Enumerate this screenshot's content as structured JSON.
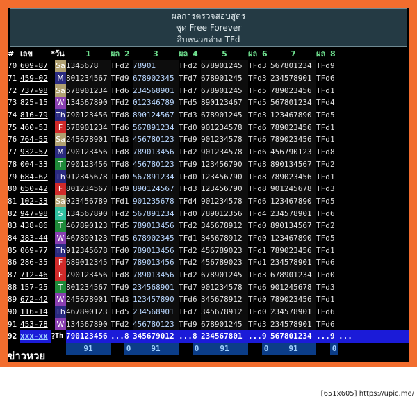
{
  "header": {
    "line1": "ผลการตรวจสอบสูตร",
    "line2": "ชุด Free Forever",
    "line3": "สิบหน่วยล่าง-TFd"
  },
  "columns": [
    "#",
    "เลข",
    "*",
    "วัน",
    "1",
    "ผล",
    "2",
    "3",
    "ผล",
    "4",
    "5",
    "ผล",
    "6",
    "7",
    "ผล",
    "8"
  ],
  "rows": [
    {
      "no": "70",
      "num": "609-87",
      "day": "Sa",
      "c1": "1345678",
      "c1b": "9",
      "c1c": "0",
      "r1": "2",
      "c2": "78901",
      "c2b": "3456",
      "r2": "2",
      "c3": "678901245",
      "r3": "3",
      "c4": "567801234",
      "r4": "9"
    },
    {
      "no": "71",
      "num": "459-02",
      "day": "M",
      "c1": "801234567",
      "r1": "9",
      "c2": "678902345",
      "r2": "7",
      "c3": "678901245",
      "r3": "3",
      "c4": "234578901",
      "r4": "6"
    },
    {
      "no": "72",
      "num": "737-98",
      "day": "Sa",
      "c1": "578901234",
      "r1": "6",
      "c2": "234568901",
      "r2": "7",
      "c3": "678901245",
      "r3": "5",
      "c4": "789023456",
      "r4": "1"
    },
    {
      "no": "73",
      "num": "825-15",
      "day": "W",
      "c1": "134567890",
      "r1": "2",
      "c2": "012346789",
      "r2": "5",
      "c3": "890123467",
      "r3": "5",
      "c4": "567801234",
      "r4": "4"
    },
    {
      "no": "74",
      "num": "816-79",
      "day": "Th",
      "c1": "790123456",
      "r1": "8",
      "c2": "890124567",
      "r2": "3",
      "c3": "678901245",
      "r3": "3",
      "c4": "123467890",
      "r4": "5"
    },
    {
      "no": "75",
      "num": "460-53",
      "day": "F",
      "c1": "578901234",
      "r1": "6",
      "c2": "567891234",
      "r2": "0",
      "c3": "901234578",
      "r3": "6",
      "c4": "789023456",
      "r4": "1"
    },
    {
      "no": "76",
      "num": "764-55",
      "day": "Sa",
      "c1": "245678901",
      "r1": "3",
      "c2": "456780123",
      "r2": "9",
      "c3": "901234578",
      "r3": "6",
      "c4": "789023456",
      "r4": "1"
    },
    {
      "no": "77",
      "num": "932-57",
      "day": "M",
      "c1": "790123456",
      "r1": "8",
      "c2": "789013456",
      "r2": "2",
      "c3": "901234578",
      "r3": "6",
      "c4": "456790123",
      "r4": "8"
    },
    {
      "no": "78",
      "num": "004-33",
      "day": "T",
      "c1": "790123456",
      "r1": "8",
      "c2": "456780123",
      "r2": "9",
      "c3": "123456790",
      "r3": "8",
      "c4": "890134567",
      "r4": "2"
    },
    {
      "no": "79",
      "num": "684-62",
      "day": "Th",
      "c1": "912345678",
      "r1": "0",
      "c2": "567891234",
      "r2": "0",
      "c3": "123456790",
      "r3": "8",
      "c4": "789023456",
      "r4": "1"
    },
    {
      "no": "80",
      "num": "650-42",
      "day": "F",
      "c1": "801234567",
      "r1": "9",
      "c2": "890124567",
      "r2": "3",
      "c3": "123456790",
      "r3": "8",
      "c4": "901245678",
      "r4": "3"
    },
    {
      "no": "81",
      "num": "102-33",
      "day": "Sa",
      "c1": "023456789",
      "r1": "1",
      "c2": "901235678",
      "r2": "4",
      "c3": "901234578",
      "r3": "6",
      "c4": "123467890",
      "r4": "5"
    },
    {
      "no": "82",
      "num": "947-98",
      "day": "S",
      "c1": "134567890",
      "r1": "2",
      "c2": "567891234",
      "r2": "0",
      "c3": "789012356",
      "r3": "4",
      "c4": "234578901",
      "r4": "6"
    },
    {
      "no": "83",
      "num": "438-86",
      "day": "T",
      "c1": "467890123",
      "r1": "5",
      "c2": "789013456",
      "r2": "2",
      "c3": "345678912",
      "r3": "0",
      "c4": "890134567",
      "r4": "2"
    },
    {
      "no": "84",
      "num": "383-44",
      "day": "W",
      "c1": "467890123",
      "r1": "5",
      "c2": "678902345",
      "r2": "1",
      "c3": "345678912",
      "r3": "0",
      "c4": "123467890",
      "r4": "5"
    },
    {
      "no": "85",
      "num": "069-77",
      "day": "Th",
      "c1": "912345678",
      "r1": "0",
      "c2": "789013456",
      "r2": "2",
      "c3": "456789023",
      "r3": "1",
      "c4": "789023456",
      "r4": "1"
    },
    {
      "no": "86",
      "num": "286-35",
      "day": "F",
      "c1": "689012345",
      "r1": "7",
      "c2": "789013456",
      "r2": "2",
      "c3": "456789023",
      "r3": "1",
      "c4": "234578901",
      "r4": "6"
    },
    {
      "no": "87",
      "num": "712-46",
      "day": "F",
      "c1": "790123456",
      "r1": "8",
      "c2": "789013456",
      "r2": "2",
      "c3": "678901245",
      "r3": "3",
      "c4": "678901234",
      "r4": "0"
    },
    {
      "no": "88",
      "num": "157-25",
      "day": "T",
      "c1": "801234567",
      "r1": "9",
      "c2": "234568901",
      "r2": "7",
      "c3": "901234578",
      "r3": "6",
      "c4": "901245678",
      "r4": "3"
    },
    {
      "no": "89",
      "num": "672-42",
      "day": "W",
      "c1": "245678901",
      "r1": "3",
      "c2": "123457890",
      "r2": "6",
      "c3": "345678912",
      "r3": "0",
      "c4": "789023456",
      "r4": "1"
    },
    {
      "no": "90",
      "num": "116-14",
      "day": "Th",
      "c1": "467890123",
      "r1": "5",
      "c2": "234568901",
      "r2": "7",
      "c3": "345678912",
      "r3": "0",
      "c4": "234578901",
      "r4": "6"
    },
    {
      "no": "91",
      "num": "453-78",
      "day": "W",
      "c1": "134567890",
      "r1": "2",
      "c2": "456780123",
      "r2": "9",
      "c3": "678901245",
      "r3": "3",
      "c4": "234578901",
      "r4": "6"
    }
  ],
  "last_row": {
    "no": "92",
    "num": "xxx-xx",
    "q": "?",
    "day": "Th",
    "c1": "790123456",
    "d1": "...",
    "r1": "8",
    "c2": "345679012",
    "d2": "...",
    "r2": "8",
    "c3": "234567801",
    "d3": "...",
    "r3": "9",
    "c4": "567801234",
    "d4": "...",
    "r4": "9",
    "dots": "..."
  },
  "summary": {
    "s1": "91",
    "z1": "0",
    "s2": "91",
    "z2": "0",
    "s3": "91",
    "z3": "0",
    "s4": "91",
    "z4": "0"
  },
  "tfd_label": "TFd",
  "footer_logo": "ข่าวหวย",
  "credit": "[651x605] https://upic.me/",
  "colors": {
    "frame": "#f26d2e",
    "header_bg": "#243a44",
    "accent_blue": "#1b1bd8",
    "green": "#6fe08f",
    "day_Sa": "#b0a070",
    "day_M": "#2a2a80",
    "day_W": "#8a3fb2",
    "day_Th": "#2a2a80",
    "day_F": "#d02a2a",
    "day_T": "#1f8a3a",
    "day_S": "#2fbfa0"
  }
}
